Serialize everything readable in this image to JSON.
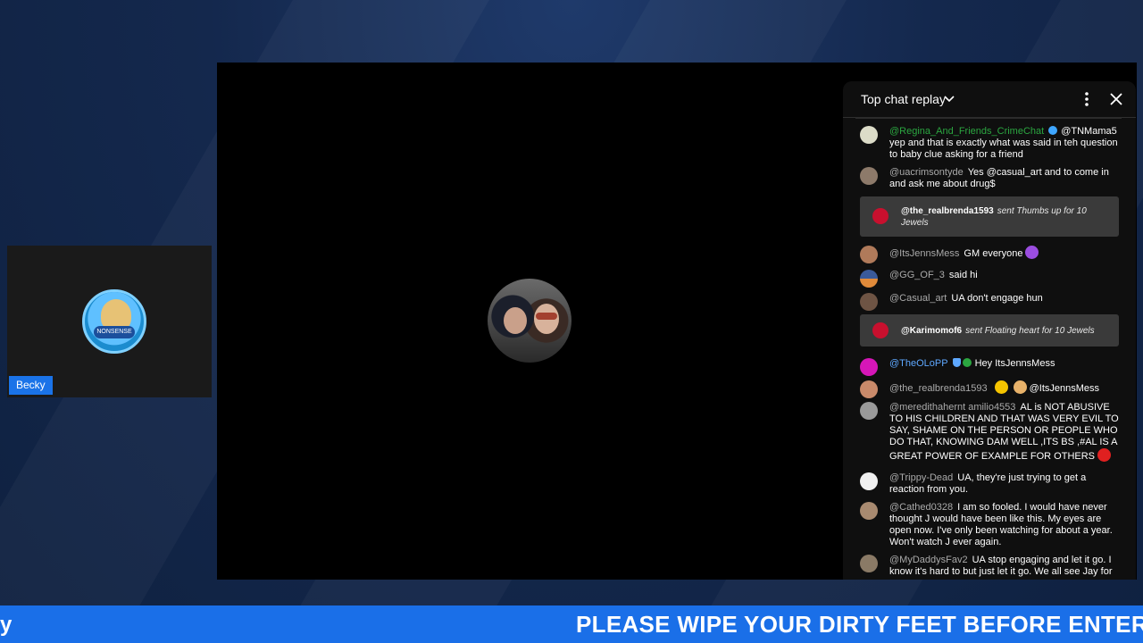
{
  "guest": {
    "name": "Becky",
    "avatar_badge": "NONSENSE"
  },
  "chat": {
    "title": "Top chat replay",
    "messages": [
      {
        "author": "@Regina_And_Friends_CrimeChat",
        "text": "@TNMama5 yep and that is exactly what was said in teh question to baby clue asking for a friend"
      },
      {
        "author": "@uacrimsontyde",
        "text": "Yes @casual_art and to come in and ask me about drug$"
      },
      {
        "author": "@ItsJennsMess",
        "text": "GM everyone"
      },
      {
        "author": "@GG_OF_3",
        "text": "said hi"
      },
      {
        "author": "@Casual_art",
        "text": "UA don't engage hun"
      },
      {
        "author": "@TheOLoPP",
        "text": "Hey ItsJennsMess"
      },
      {
        "author": "@the_realbrenda1593",
        "text": "@ItsJennsMess"
      },
      {
        "author": "@meredithahernt amilio4553",
        "text": "AL is NOT ABUSIVE TO HIS CHILDREN AND THAT WAS VERY EVIL TO SAY, SHAME ON THE PERSON OR PEOPLE WHO DO THAT, KNOWING DAM WELL ,ITS BS ,#AL IS A GREAT POWER OF EXAMPLE FOR OTHERS"
      },
      {
        "author": "@Trippy-Dead",
        "text": "UA, they're just trying to get a reaction from you."
      },
      {
        "author": "@Cathed0328",
        "text": "I am so fooled. I would have never thought J would have been like this. My eyes are open now. I've only been watching for about a year. Won't watch J ever again."
      },
      {
        "author": "@MyDaddysFav2",
        "text": "UA stop engaging and let it go. I know it's hard to but just let it go. We all see Jay for"
      }
    ],
    "jewels": [
      {
        "author": "@the_realbrenda1593",
        "text": "sent Thumbs up for 10 Jewels"
      },
      {
        "author": "@Karimomof6",
        "text": "sent Floating heart for 10 Jewels"
      }
    ]
  },
  "ticker": {
    "left_fragment": "y",
    "text": "PLEASE WIPE YOUR DIRTY FEET BEFORE ENTERING"
  },
  "colors": {
    "ticker_bg": "#1a6fe8",
    "name_tag_bg": "#1a73e8",
    "chat_bg": "#0f0f0f",
    "jewel_bg": "#3a3a3a"
  }
}
